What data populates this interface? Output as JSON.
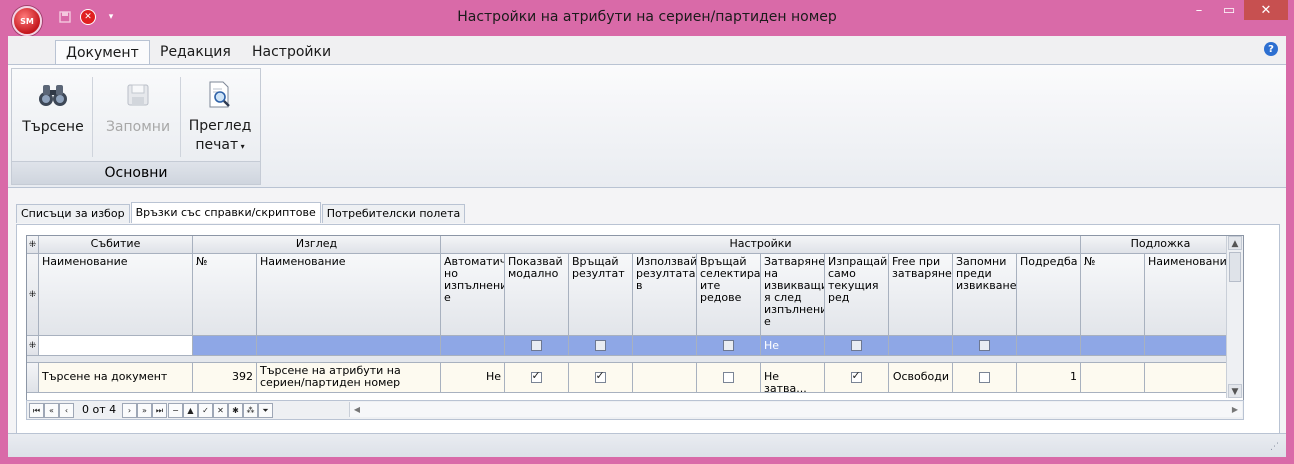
{
  "window": {
    "title": "Настройки на атрибути на сериен/партиден номер",
    "app_badge": "SM"
  },
  "ribbon": {
    "tabs": [
      {
        "label": "Документ",
        "active": true
      },
      {
        "label": "Редакция",
        "active": false
      },
      {
        "label": "Настройки",
        "active": false
      }
    ],
    "group": {
      "label": "Основни",
      "buttons": [
        {
          "label": "Търсене",
          "icon": "binoculars-icon",
          "enabled": true
        },
        {
          "label": "Запомни",
          "icon": "save-icon",
          "enabled": false
        },
        {
          "label": "Преглед",
          "label2": "печат",
          "icon": "print-preview-icon",
          "enabled": true
        }
      ]
    }
  },
  "page_tabs": [
    {
      "label": "Списъци за избор",
      "active": false
    },
    {
      "label": "Връзки със справки/скриптове",
      "active": true
    },
    {
      "label": "Потребителски полета",
      "active": false
    }
  ],
  "grid": {
    "bands": [
      {
        "label": "Събитие"
      },
      {
        "label": "Изглед"
      },
      {
        "label": "Настройки"
      },
      {
        "label": "Подложка"
      }
    ],
    "columns": [
      "Наименование",
      "№",
      "Наименование",
      "Автоматич но изпълнени е",
      "Показвай модално",
      "Връщай резултат",
      "Използвай резултата в",
      "Връщай селектиран ите редове",
      "Затваряне на извикващи я след изпълнени е",
      "Изпращай само текущия ред",
      "Free при затваряне",
      "Запомни преди извикване",
      "Подредба",
      "№",
      "Наименование"
    ],
    "filter_row": {
      "close_mode": "Не затва..."
    },
    "rows": [
      {
        "event_name": "Търсене на документ",
        "view_no": "392",
        "view_name": "Търсене на атрибути на сериен/партиден номер",
        "auto_exec": "Не",
        "modal": true,
        "return_result": true,
        "use_result_in": "",
        "return_selected": false,
        "close_mode": "Не затва...",
        "send_current": true,
        "free_on_close": "Освободи",
        "remember_before": false,
        "order": "1",
        "sub_no": "",
        "sub_name": ""
      }
    ]
  },
  "navigator": {
    "position": "0 от 4"
  }
}
